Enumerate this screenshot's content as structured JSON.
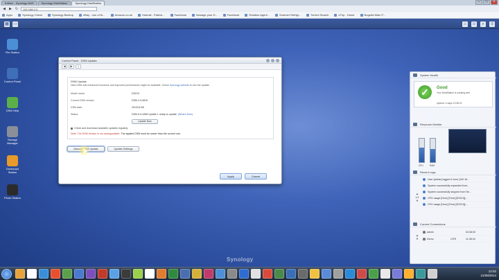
{
  "browser": {
    "tabs": [
      {
        "label": "Edition - Synology NAS"
      },
      {
        "label": "Synology DiskStation"
      },
      {
        "label": "Synology DiskStation"
      }
    ],
    "url": "192.168.0.3"
  },
  "bookmarks": [
    {
      "label": "Apps"
    },
    {
      "label": "Synology Check"
    },
    {
      "label": "Synology Backup"
    },
    {
      "label": "eBay - one of th..."
    },
    {
      "label": "Amazon.co.uk"
    },
    {
      "label": "Hotmail - Patrick..."
    },
    {
      "label": "Facebook"
    },
    {
      "label": "Manage your D..."
    },
    {
      "label": "Facebook"
    },
    {
      "label": "Rotation Agent..."
    },
    {
      "label": "Summer Refrigi..."
    },
    {
      "label": "Torrent Search"
    },
    {
      "label": "eTrip - Home"
    },
    {
      "label": "Bugzilla Main P..."
    }
  ],
  "desktop_icons": [
    {
      "label": "File Station",
      "color": "#4d8fd6"
    },
    {
      "label": "Control Panel",
      "color": "#3e6fb8"
    },
    {
      "label": "DSM Help",
      "color": "#5bb04a"
    },
    {
      "label": "Storage Manager",
      "color": "#8a8f99"
    },
    {
      "label": "Download Station",
      "color": "#e89a2b"
    },
    {
      "label": "Photo Station",
      "color": "#2b2b2b"
    }
  ],
  "window": {
    "title": "Control Panel - DSM Update",
    "heading": "DSM Update",
    "description": "New DSM with enhanced functions and improved performance might be available. Check",
    "desc_link": "Synology website",
    "desc_tail": "to see the update.",
    "rows": [
      {
        "label": "Model name:",
        "value": "DS213"
      },
      {
        "label": "Current DSM version:",
        "value": "DSM 4.3-3810"
      },
      {
        "label": "DSM date:",
        "value": "2013/11/06"
      },
      {
        "label": "Status:",
        "value": "DSM 5.0-4458 Update 1 ready to update.",
        "link": "(What's New)"
      }
    ],
    "update_button": "Update Now",
    "checkbox_label": "Check and download available updates regularly",
    "note_red": "Note: The DSM version is not downgradable.",
    "note_tail": "The applied DSM must be newer than the current one.",
    "manual_button": "Manual DSM Update",
    "settings_button": "Update Settings",
    "apply_button": "Apply",
    "cancel_button": "Cancel"
  },
  "widgets": {
    "health": {
      "title": "System Health",
      "status": "Good",
      "description": "Your DiskStation is working well.",
      "uptime": "Uptime: 4 days 12:38:21"
    },
    "resource": {
      "title": "Resource Monitor",
      "cpu_label": "CPU",
      "ram_label": "RAM",
      "cpu_level": 0.62,
      "ram_level": 0.55
    },
    "logs": {
      "title": "Recent Logs",
      "nav": "1/1",
      "items": [
        "User [admin] logged in from [192.16...",
        "System successfully expanded from...",
        "System successfully stopped from Ne...",
        "CPU usage [Dsm] [Time] [DS213j] ...",
        "CPU usage [Dsm] [Time] [DS213j] ..."
      ]
    },
    "connections": {
      "title": "Current Connections",
      "rows": [
        {
          "user": "admin",
          "service": "",
          "time": "04:38:00"
        },
        {
          "user": "Demo",
          "service": "CIFS",
          "time": "11:38:44"
        }
      ]
    }
  },
  "brand": "Synology",
  "taskbar": {
    "apps": [
      "#e6a33b",
      "#ffffff",
      "#3a8fd8",
      "#e8502f",
      "#5ba04b",
      "#4a7ad0",
      "#7b4fbd",
      "#c23a2b",
      "#5aa0e6",
      "#3b3b3b",
      "#9bd04b",
      "#ffffff",
      "#e27c2f",
      "#2f8a3f",
      "#4a6fb0",
      "#d6b13a",
      "#c03b6a",
      "#4f8fd8",
      "#8a8a8a",
      "#2f6bd0",
      "#e0e0e0",
      "#d84b3a",
      "#4a8a4a",
      "#3a6fb8",
      "#6a6a6a",
      "#f0c040",
      "#5a8ad8",
      "#a0a0a0",
      "#2a8ad8",
      "#d04a4a",
      "#4aa04a",
      "#e8e8e8",
      "#7a7ad8",
      "#ffb030",
      "#3a9a9a",
      "#d0d0d0"
    ],
    "time": "12:02",
    "date": "21/08/2014"
  }
}
